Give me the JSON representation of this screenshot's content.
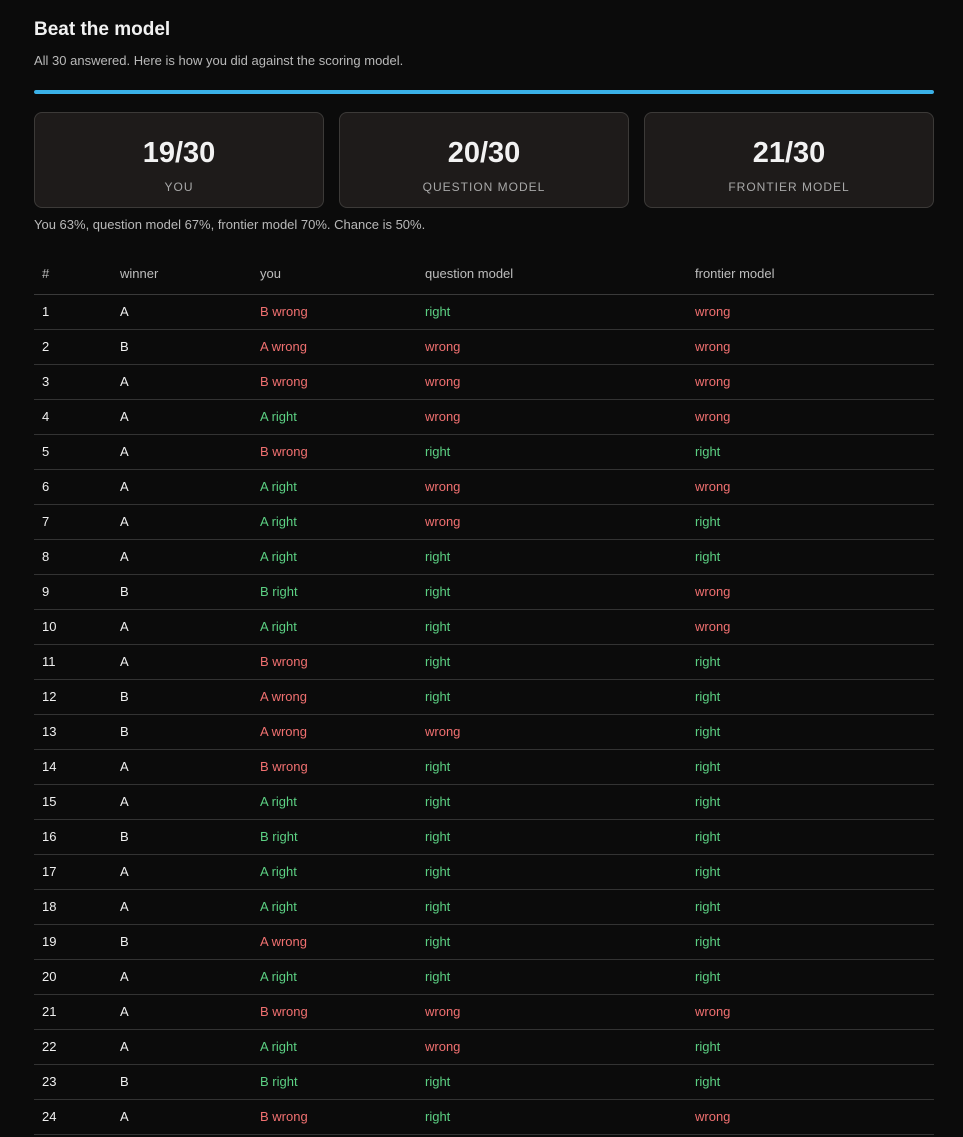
{
  "header": {
    "title": "Beat the model",
    "subtitle": "All 30 answered. Here is how you did against the scoring model."
  },
  "progress": {
    "fraction": 1.0,
    "color": "#3ab1e8"
  },
  "scores": [
    {
      "score": "19/30",
      "label": "YOU"
    },
    {
      "score": "20/30",
      "label": "QUESTION MODEL"
    },
    {
      "score": "21/30",
      "label": "FRONTIER MODEL"
    }
  ],
  "summary": "You 63%, question model 67%, frontier model 70%. Chance is 50%.",
  "colors": {
    "right": "#5cd083",
    "wrong": "#f07070"
  },
  "table": {
    "columns": [
      "#",
      "winner",
      "you",
      "question model",
      "frontier model"
    ],
    "rows": [
      {
        "num": "1",
        "winner": "A",
        "you": "B wrong",
        "question": "right",
        "frontier": "wrong"
      },
      {
        "num": "2",
        "winner": "B",
        "you": "A wrong",
        "question": "wrong",
        "frontier": "wrong"
      },
      {
        "num": "3",
        "winner": "A",
        "you": "B wrong",
        "question": "wrong",
        "frontier": "wrong"
      },
      {
        "num": "4",
        "winner": "A",
        "you": "A right",
        "question": "wrong",
        "frontier": "wrong"
      },
      {
        "num": "5",
        "winner": "A",
        "you": "B wrong",
        "question": "right",
        "frontier": "right"
      },
      {
        "num": "6",
        "winner": "A",
        "you": "A right",
        "question": "wrong",
        "frontier": "wrong"
      },
      {
        "num": "7",
        "winner": "A",
        "you": "A right",
        "question": "wrong",
        "frontier": "right"
      },
      {
        "num": "8",
        "winner": "A",
        "you": "A right",
        "question": "right",
        "frontier": "right"
      },
      {
        "num": "9",
        "winner": "B",
        "you": "B right",
        "question": "right",
        "frontier": "wrong"
      },
      {
        "num": "10",
        "winner": "A",
        "you": "A right",
        "question": "right",
        "frontier": "wrong"
      },
      {
        "num": "11",
        "winner": "A",
        "you": "B wrong",
        "question": "right",
        "frontier": "right"
      },
      {
        "num": "12",
        "winner": "B",
        "you": "A wrong",
        "question": "right",
        "frontier": "right"
      },
      {
        "num": "13",
        "winner": "B",
        "you": "A wrong",
        "question": "wrong",
        "frontier": "right"
      },
      {
        "num": "14",
        "winner": "A",
        "you": "B wrong",
        "question": "right",
        "frontier": "right"
      },
      {
        "num": "15",
        "winner": "A",
        "you": "A right",
        "question": "right",
        "frontier": "right"
      },
      {
        "num": "16",
        "winner": "B",
        "you": "B right",
        "question": "right",
        "frontier": "right"
      },
      {
        "num": "17",
        "winner": "A",
        "you": "A right",
        "question": "right",
        "frontier": "right"
      },
      {
        "num": "18",
        "winner": "A",
        "you": "A right",
        "question": "right",
        "frontier": "right"
      },
      {
        "num": "19",
        "winner": "B",
        "you": "A wrong",
        "question": "right",
        "frontier": "right"
      },
      {
        "num": "20",
        "winner": "A",
        "you": "A right",
        "question": "right",
        "frontier": "right"
      },
      {
        "num": "21",
        "winner": "A",
        "you": "B wrong",
        "question": "wrong",
        "frontier": "wrong"
      },
      {
        "num": "22",
        "winner": "A",
        "you": "A right",
        "question": "wrong",
        "frontier": "right"
      },
      {
        "num": "23",
        "winner": "B",
        "you": "B right",
        "question": "right",
        "frontier": "right"
      },
      {
        "num": "24",
        "winner": "A",
        "you": "B wrong",
        "question": "right",
        "frontier": "wrong"
      }
    ]
  }
}
